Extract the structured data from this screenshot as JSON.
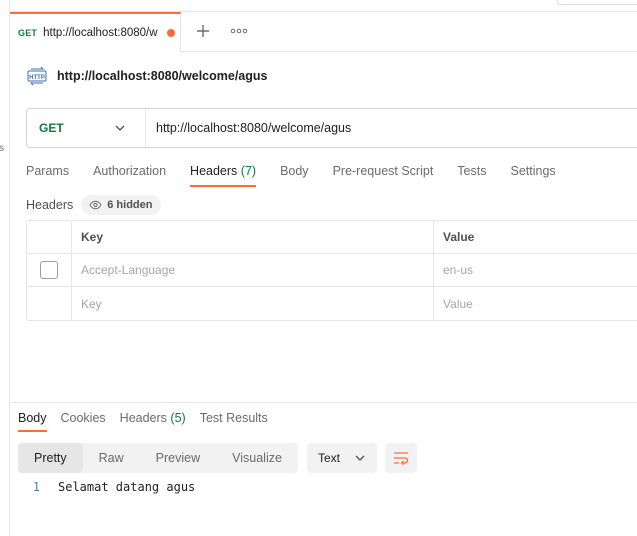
{
  "tab": {
    "method": "GET",
    "url": "http://localhost:8080/w",
    "unsaved_dot_color": "#ff6c37",
    "add_icon": "plus-icon",
    "more_icon": "more-horizontal-icon"
  },
  "request": {
    "title": "http://localhost:8080/welcome/agus",
    "icon": "http-icon",
    "method": "GET",
    "url": "http://localhost:8080/welcome/agus"
  },
  "request_tabs": [
    {
      "label": "Params",
      "count": ""
    },
    {
      "label": "Authorization",
      "count": ""
    },
    {
      "label": "Headers",
      "count": "(7)"
    },
    {
      "label": "Body",
      "count": ""
    },
    {
      "label": "Pre-request Script",
      "count": ""
    },
    {
      "label": "Tests",
      "count": ""
    },
    {
      "label": "Settings",
      "count": ""
    }
  ],
  "headers": {
    "label": "Headers",
    "hidden_count": "6 hidden",
    "columns": {
      "key": "Key",
      "value": "Value"
    },
    "rows": [
      {
        "key": "Accept-Language",
        "value": "en-us",
        "enabled": false
      }
    ],
    "placeholder": {
      "key": "Key",
      "value": "Value"
    }
  },
  "response_tabs": [
    {
      "label": "Body",
      "count": ""
    },
    {
      "label": "Cookies",
      "count": ""
    },
    {
      "label": "Headers",
      "count": "(5)"
    },
    {
      "label": "Test Results",
      "count": ""
    }
  ],
  "view_modes": [
    "Pretty",
    "Raw",
    "Preview",
    "Visualize"
  ],
  "format": "Text",
  "body_lines": [
    {
      "n": "1",
      "text": "Selamat datang agus"
    }
  ],
  "colors": {
    "accent": "#ff6c37",
    "get_method": "#0f7b3c"
  }
}
